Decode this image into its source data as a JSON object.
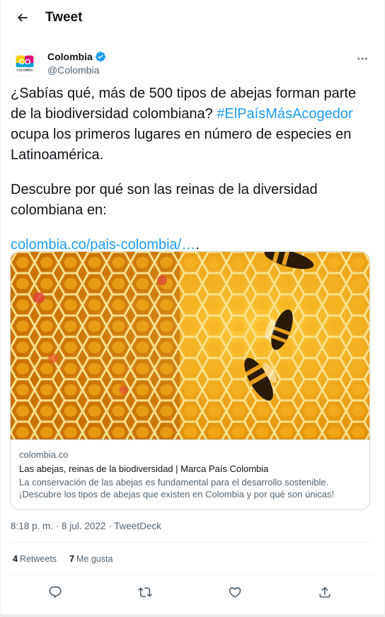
{
  "header": {
    "title": "Tweet",
    "back_icon": "arrow-left-icon"
  },
  "author": {
    "avatar_text": "CO",
    "avatar_subtext": "COLOMBIA",
    "display_name": "Colombia",
    "handle": "@Colombia",
    "verified_icon": "verified-badge-icon",
    "more_icon": "more-horizontal-icon"
  },
  "tweet": {
    "paragraph1": {
      "line1": "¿Sabías qué, más de 500 tipos de abejas forman parte",
      "line2_text": "de la biodiversidad colombiana? ",
      "line2_hashtag": "#ElPaísMásAcogedor",
      "line3": "ocupa los primeros lugares en número de especies en",
      "line4": "Latinoamérica."
    },
    "paragraph2": {
      "line1": "Descubre por qué son las reinas de la diversidad",
      "line2": "colombiana en:"
    },
    "link_text": "colombia.co/pais-colombia/…",
    "link_suffix": "."
  },
  "card": {
    "domain": "colombia.co",
    "title": "Las abejas, reinas de la biodiversidad | Marca País Colombia",
    "description_line1": "La conservación de las abejas es fundamental para el desarrollo sostenible.",
    "description_line2": "¡Descubre los tipos de abejas que existen en Colombia y por qué son únicas!"
  },
  "meta": {
    "time": "8:18 p. m.",
    "separator": " · ",
    "date": "8 jul. 2022",
    "source": "TweetDeck"
  },
  "stats": {
    "retweets_count": "4",
    "retweets_label": "Retweets",
    "likes_count": "7",
    "likes_label": "Me gusta"
  },
  "actions": {
    "reply_icon": "reply-icon",
    "retweet_icon": "retweet-icon",
    "like_icon": "heart-icon",
    "share_icon": "share-icon"
  },
  "colors": {
    "link": "#1d9bf0",
    "text": "#0f1419",
    "secondary": "#536471",
    "border": "#cfd9de",
    "avatar_logo": "#e3007d"
  }
}
